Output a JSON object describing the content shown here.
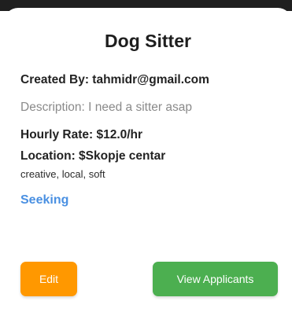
{
  "card": {
    "title": "Dog Sitter",
    "created_by": "Created By: tahmidr@gmail.com",
    "description": "Description: I need a sitter asap",
    "hourly_rate": "Hourly Rate: $12.0/hr",
    "location": "Location: $Skopje centar",
    "tags": "creative, local, soft",
    "status": "Seeking"
  },
  "actions": {
    "edit_label": "Edit",
    "view_applicants_label": "View Applicants"
  },
  "colors": {
    "status": "#4a90e2",
    "edit_button": "#ff9800",
    "view_applicants_button": "#4caf50"
  }
}
